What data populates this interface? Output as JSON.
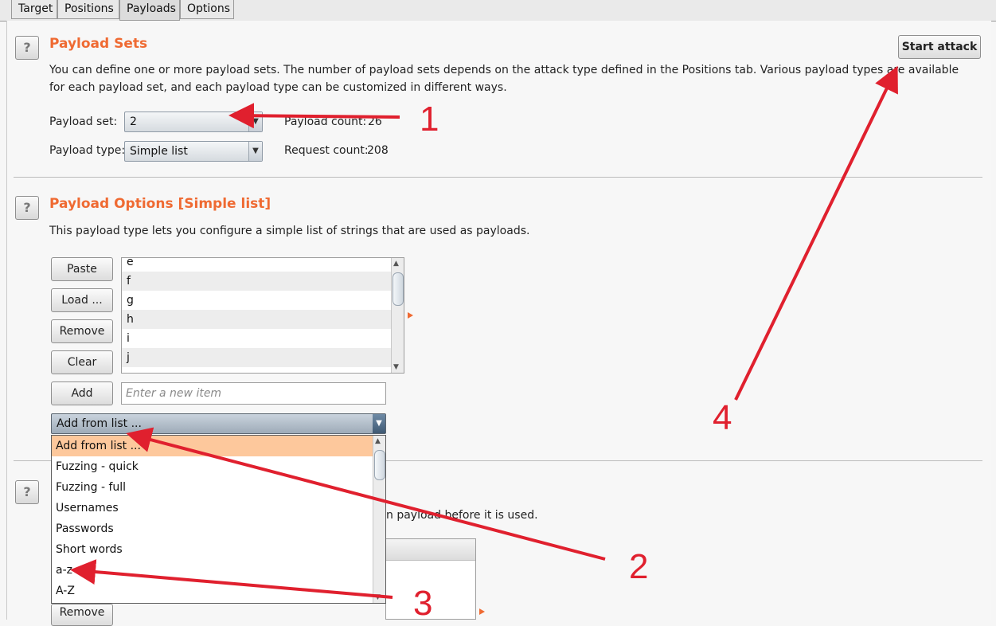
{
  "tabs": [
    "Target",
    "Positions",
    "Payloads",
    "Options"
  ],
  "payload_sets": {
    "heading": "Payload Sets",
    "desc_line1": "You can define one or more payload sets. The number of payload sets depends on the attack type defined in the Positions tab. Various payload types are available",
    "desc_line2": "for each payload set, and each payload type can be customized in different ways.",
    "set_label": "Payload set:",
    "set_value": "2",
    "type_label": "Payload type:",
    "type_value": "Simple list",
    "count_label": "Payload count:",
    "count_value": "26",
    "request_label": "Request count:",
    "request_value": "208",
    "start_label": "Start attack"
  },
  "payload_options": {
    "heading": "Payload Options [Simple list]",
    "desc": "This payload type lets you configure a simple list of strings that are used as payloads.",
    "buttons": {
      "paste": "Paste",
      "load": "Load ...",
      "remove": "Remove",
      "clear": "Clear",
      "add": "Add"
    },
    "list_items": [
      "e",
      "f",
      "g",
      "h",
      "i",
      "j"
    ],
    "new_item_placeholder": "Enter a new item",
    "add_from_list": "Add from list ..."
  },
  "dropdown": {
    "items": [
      "Add from list ...",
      "Fuzzing - quick",
      "Fuzzing - full",
      "Usernames",
      "Passwords",
      "Short words",
      "a-z",
      "A-Z"
    ]
  },
  "processing": {
    "partial_desc": "n payload before it is used.",
    "remove_label": "Remove"
  },
  "annotations": {
    "n1": "1",
    "n2": "2",
    "n3": "3",
    "n4": "4"
  },
  "colors": {
    "heading": "#ef6a32",
    "selected_item": "#fdc89c",
    "annotation": "#e0202e"
  }
}
